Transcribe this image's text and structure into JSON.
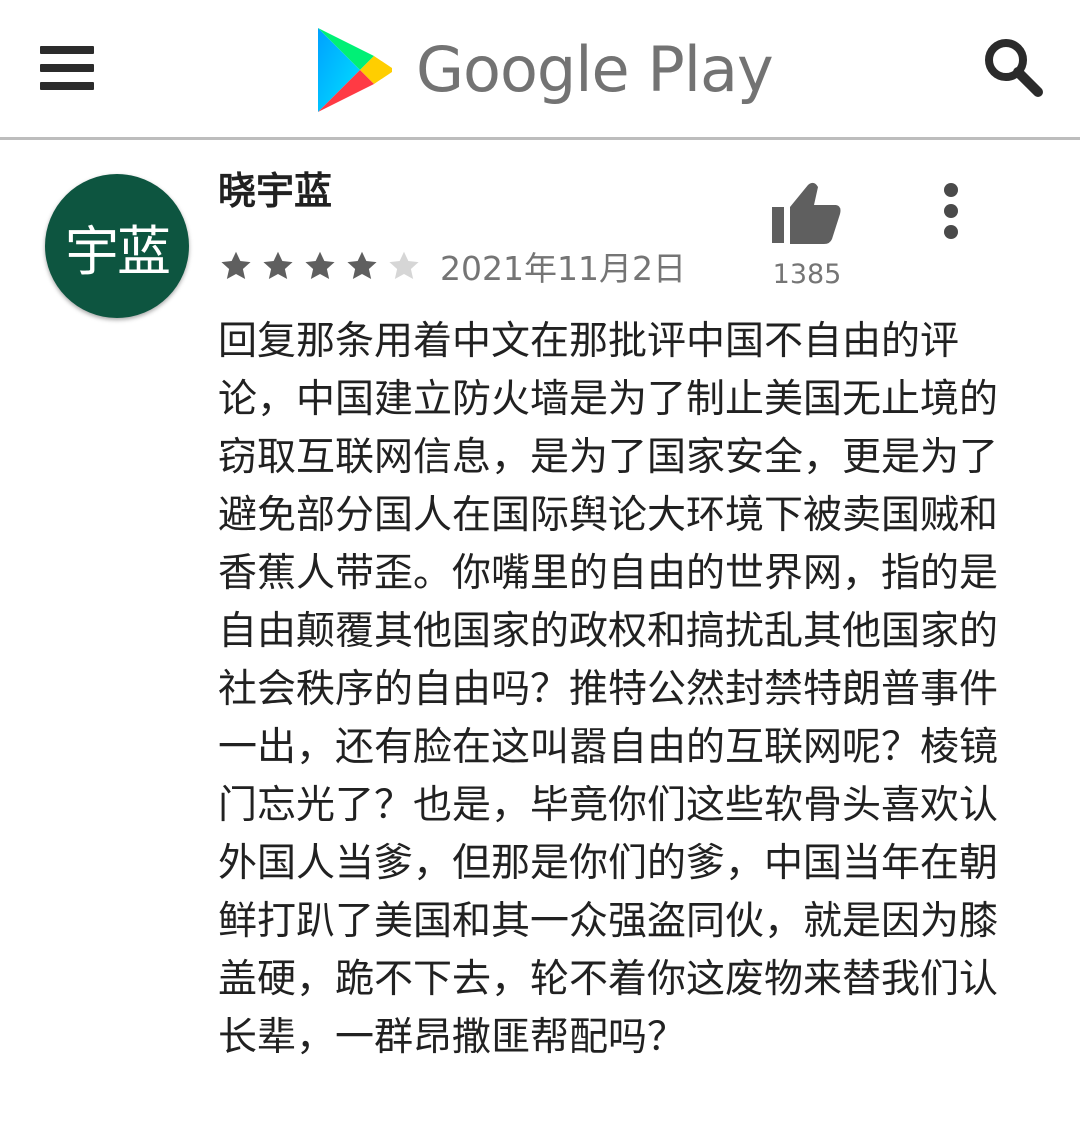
{
  "header": {
    "brand": "Google Play",
    "menu_icon": "hamburger-menu-icon",
    "search_icon": "search-icon",
    "play_logo_colors": [
      "#00d7fe",
      "#00f076",
      "#ffce00",
      "#ff3a44"
    ]
  },
  "review": {
    "avatar_text": "宇蓝",
    "avatar_color": "#0d5540",
    "author": "晓宇蓝",
    "rating": 4,
    "rating_max": 5,
    "date": "2021年11月2日",
    "helpful_count": "1385",
    "helpful_icon": "thumb-up-icon",
    "more_icon": "more-vert-icon",
    "text": "回复那条用着中文在那批评中国不自由的评论，中国建立防火墙是为了制止美国无止境的窃取互联网信息，是为了国家安全，更是为了避免部分国人在国际舆论大环境下被卖国贼和香蕉人带歪。你嘴里的自由的世界网，指的是自由颠覆其他国家的政权和搞扰乱其他国家的社会秩序的自由吗？推特公然封禁特朗普事件一出，还有脸在这叫嚣自由的互联网呢？棱镜门忘光了？也是，毕竟你们这些软骨头喜欢认外国人当爹，但那是你们的爹，中国当年在朝鲜打趴了美国和其一众强盗同伙，就是因为膝盖硬，跪不下去，轮不着你这废物来替我们认长辈，一群昂撒匪帮配吗？"
  }
}
